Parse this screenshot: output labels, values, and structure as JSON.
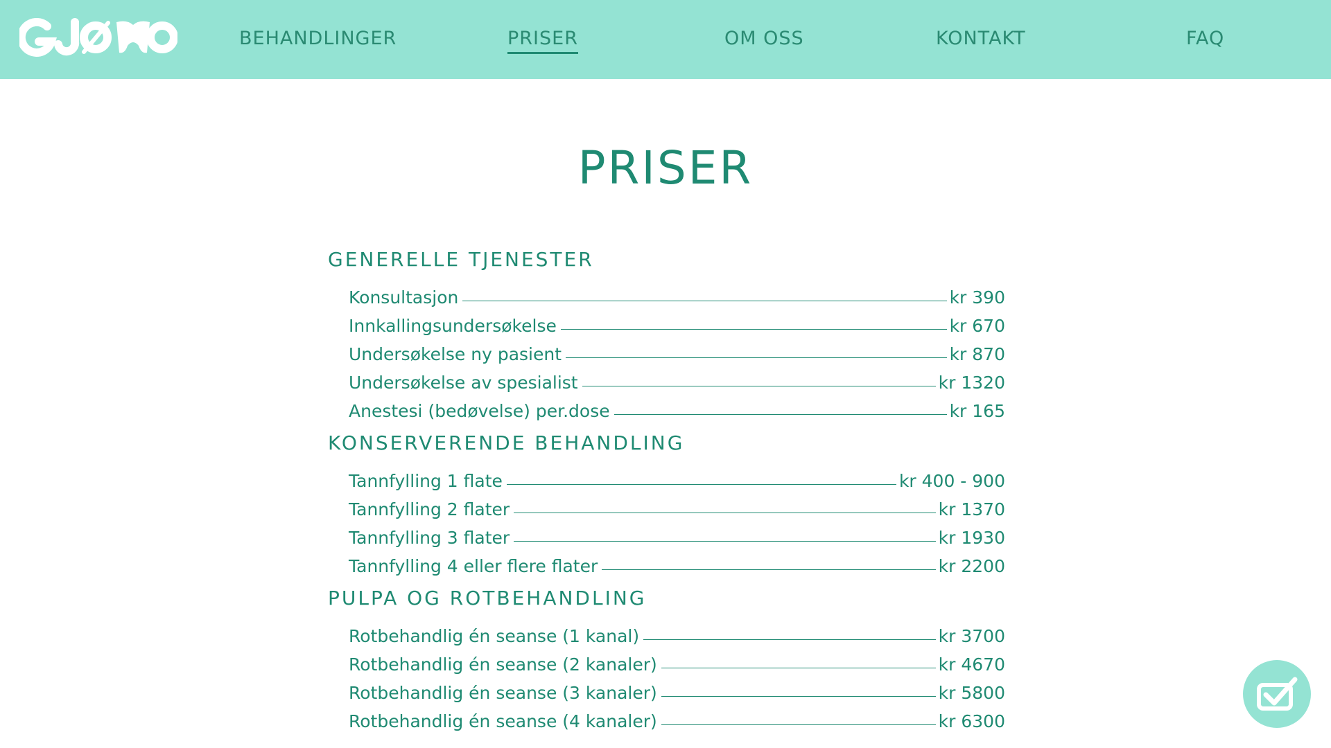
{
  "brand": {
    "logo_text": "GJØWO",
    "accent": "#1f8a72",
    "nav_bg": "#94e3d3"
  },
  "nav": {
    "items": [
      {
        "label": "BEHANDLINGER"
      },
      {
        "label": "PRISER",
        "active": true
      },
      {
        "label": "OM OSS"
      },
      {
        "label": "KONTAKT"
      },
      {
        "label": "FAQ"
      }
    ]
  },
  "page": {
    "title": "PRISER"
  },
  "sections": [
    {
      "title": "GENERELLE TJENESTER",
      "items": [
        {
          "label": "Konsultasjon",
          "price": "kr 390"
        },
        {
          "label": "Innkallingsundersøkelse",
          "price": "kr 670"
        },
        {
          "label": "Undersøkelse ny pasient",
          "price": "kr 870"
        },
        {
          "label": "Undersøkelse av spesialist",
          "price": "kr 1320"
        },
        {
          "label": "Anestesi (bedøvelse) per.dose",
          "price": "kr 165"
        }
      ]
    },
    {
      "title": "KONSERVERENDE BEHANDLING",
      "items": [
        {
          "label": "Tannfylling 1 flate",
          "price": "kr 400 - 900"
        },
        {
          "label": "Tannfylling 2 flater",
          "price": "kr 1370"
        },
        {
          "label": "Tannfylling 3 flater",
          "price": "kr 1930"
        },
        {
          "label": "Tannfylling 4 eller flere flater",
          "price": "kr 2200"
        }
      ]
    },
    {
      "title": "PULPA OG ROTBEHANDLING",
      "items": [
        {
          "label": "Rotbehandlig én seanse (1 kanal)",
          "price": "kr 3700"
        },
        {
          "label": "Rotbehandlig én seanse (2 kanaler)",
          "price": "kr 4670"
        },
        {
          "label": "Rotbehandlig én seanse (3 kanaler)",
          "price": "kr 5800"
        },
        {
          "label": "Rotbehandlig én seanse (4 kanaler)",
          "price": "kr 6300"
        }
      ]
    }
  ],
  "icons": {
    "floating_button": "checkbox-check-icon"
  }
}
